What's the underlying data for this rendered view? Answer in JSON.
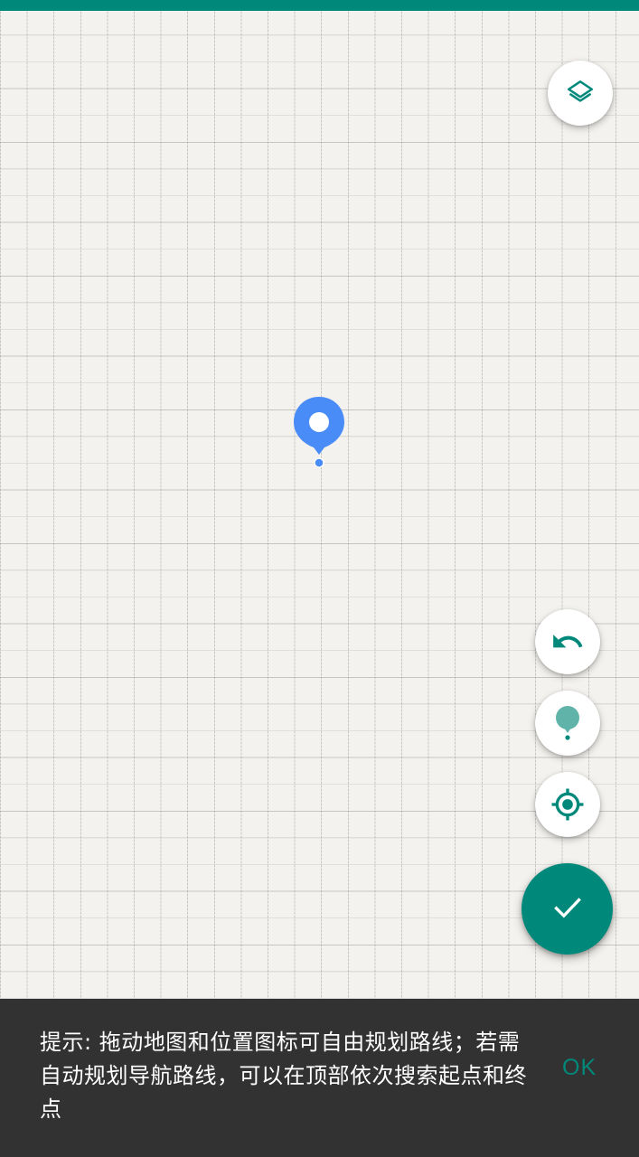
{
  "colors": {
    "accent": "#00897b",
    "pin": "#4a8cf7",
    "snackbar_bg": "#323232"
  },
  "map": {
    "layers_button_icon": "layers-icon",
    "undo_button_icon": "undo-icon",
    "marker_button_icon": "map-marker-icon",
    "locate_button_icon": "my-location-icon",
    "confirm_button_icon": "check-icon",
    "center_pin_icon": "location-pin-icon"
  },
  "snackbar": {
    "message": "提示: 拖动地图和位置图标可自由规划路线；若需自动规划导航路线，可以在顶部依次搜索起点和终点",
    "action_label": "OK"
  }
}
